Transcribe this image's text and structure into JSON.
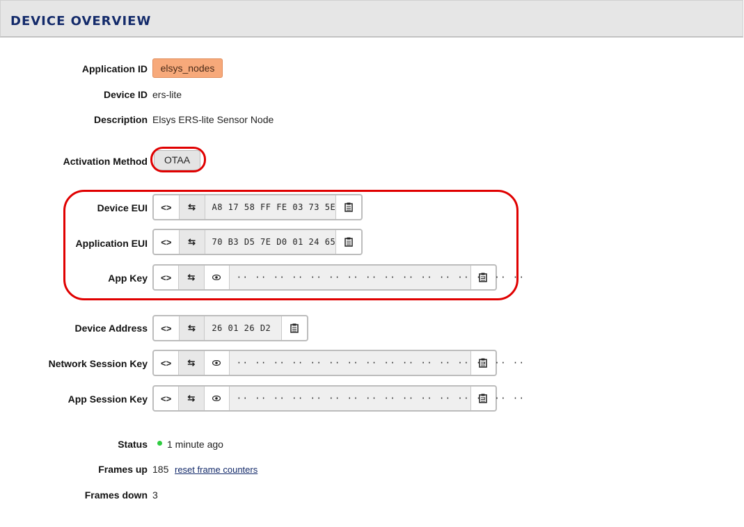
{
  "header": {
    "title": "DEVICE OVERVIEW"
  },
  "application_id": {
    "label": "Application ID",
    "value": "elsys_nodes"
  },
  "device_id": {
    "label": "Device ID",
    "value": "ers-lite"
  },
  "description": {
    "label": "Description",
    "value": "Elsys ERS-lite Sensor Node"
  },
  "activation": {
    "label": "Activation Method",
    "value": "OTAA"
  },
  "device_eui": {
    "label": "Device EUI",
    "value": "A8 17 58 FF FE 03 73 5E"
  },
  "app_eui": {
    "label": "Application EUI",
    "value": "70 B3 D5 7E D0 01 24 65"
  },
  "app_key": {
    "label": "App Key",
    "value": "·· ·· ·· ·· ·· ·· ·· ·· ·· ·· ·· ·· ·· ·· ·· ··"
  },
  "device_address": {
    "label": "Device Address",
    "value": "26 01 26 D2"
  },
  "nwk_skey": {
    "label": "Network Session Key",
    "value": "·· ·· ·· ·· ·· ·· ·· ·· ·· ·· ·· ·· ·· ·· ·· ··"
  },
  "app_skey": {
    "label": "App Session Key",
    "value": "·· ·· ·· ·· ·· ·· ·· ·· ·· ·· ·· ·· ·· ·· ·· ··"
  },
  "status": {
    "label": "Status",
    "value": "1 minute ago",
    "color": "#2ecc40"
  },
  "frames_up": {
    "label": "Frames up",
    "value": "185",
    "reset_link": "reset frame counters"
  },
  "frames_down": {
    "label": "Frames down",
    "value": "3"
  },
  "icons": {
    "toggle_format": "code-brackets-icon",
    "swap": "swap-arrows-icon",
    "show": "eye-icon",
    "copy": "clipboard-icon"
  }
}
